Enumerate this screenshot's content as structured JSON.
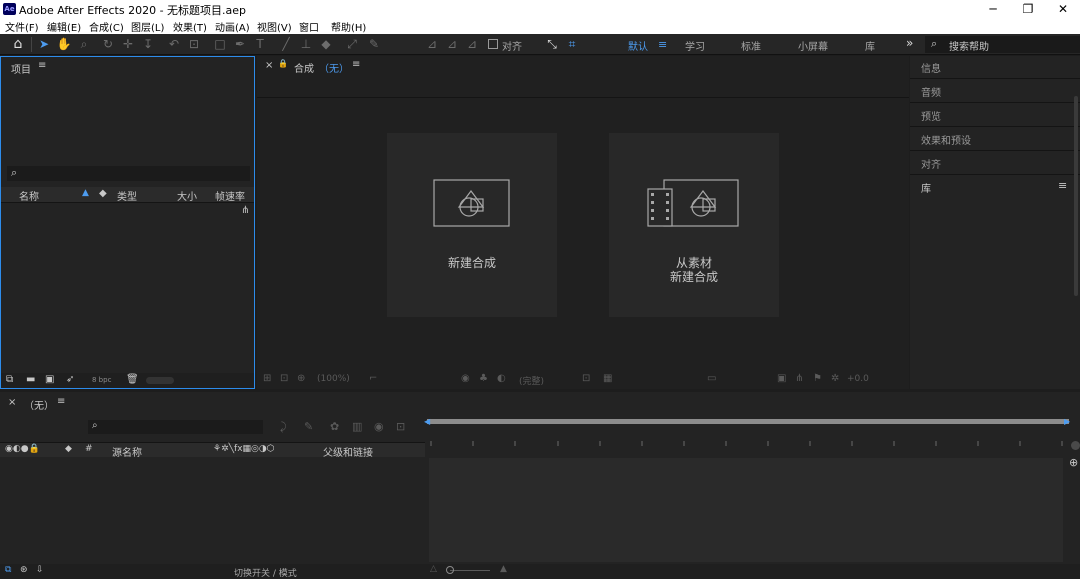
{
  "window": {
    "logo": "Ae",
    "title": "Adobe After Effects 2020 - 无标题项目.aep",
    "minimize": "─",
    "maximize": "❐",
    "close": "✕"
  },
  "menu": [
    "文件(F)",
    "编辑(E)",
    "合成(C)",
    "图层(L)",
    "效果(T)",
    "动画(A)",
    "视图(V)",
    "窗口",
    "帮助(H)"
  ],
  "toolbar": {
    "snap_label": "对齐",
    "workspaces": [
      "默认",
      "学习",
      "标准",
      "小屏幕",
      "库"
    ],
    "active_workspace": "默认",
    "more": "»",
    "search_placeholder": "搜索帮助"
  },
  "project": {
    "tab": "项目",
    "menu": "≡",
    "search_glyph": "⌕",
    "columns": [
      "名称",
      "类型",
      "大小",
      "帧速率"
    ],
    "bpc": "8 bpc"
  },
  "comp": {
    "close": "×",
    "lock": "🔒",
    "tab": "合成",
    "name": "（无）",
    "menu": "≡",
    "new_comp": "新建合成",
    "from_footage_line1": "从素材",
    "from_footage_line2": "新建合成",
    "footer_zoom": "(100%)",
    "footer_res": "(完整)",
    "footer_offset": "+0.0"
  },
  "right_panels": [
    "信息",
    "音频",
    "预览",
    "效果和预设",
    "对齐",
    "库"
  ],
  "timeline": {
    "close": "×",
    "name": "（无）",
    "menu": "≡",
    "col_source": "源名称",
    "col_parent": "父级和链接",
    "footer_toggle": "切换开关 / 模式"
  },
  "colors": {
    "accent": "#4d9cf0",
    "panel": "#232323",
    "bg": "#1d1d1d"
  }
}
